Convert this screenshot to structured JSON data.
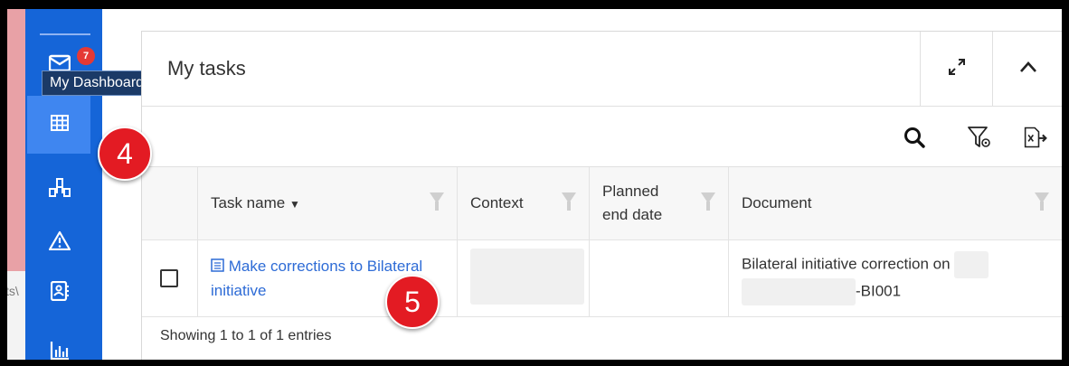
{
  "sidebar": {
    "badge_count": "7",
    "tooltip": "My Dashboard",
    "items": [
      {
        "icon": "mail-icon"
      },
      {
        "icon": "grid-table-icon",
        "active": true
      },
      {
        "icon": "org-chart-icon"
      },
      {
        "icon": "warning-icon"
      },
      {
        "icon": "contact-card-icon"
      },
      {
        "icon": "bar-chart-icon"
      }
    ]
  },
  "background_text": "ts\\",
  "annotations": {
    "step4": "4",
    "step5": "5"
  },
  "panel": {
    "title": "My tasks",
    "columns": [
      {
        "label": "Task name",
        "sortable": true
      },
      {
        "label": "Context"
      },
      {
        "label": "Planned end date"
      },
      {
        "label": "Document"
      }
    ],
    "rows": [
      {
        "task_name": "Make corrections to Bilateral initiative",
        "context": "",
        "planned_end_date": "",
        "document_line1": "Bilateral initiative correction on",
        "document_suffix": "-BI001"
      }
    ],
    "footer": "Showing 1 to 1 of 1 entries"
  },
  "colors": {
    "sidebar": "#1565d8",
    "active": "#3f86f0",
    "link": "#2d6bd6",
    "badge": "#e31b23"
  }
}
